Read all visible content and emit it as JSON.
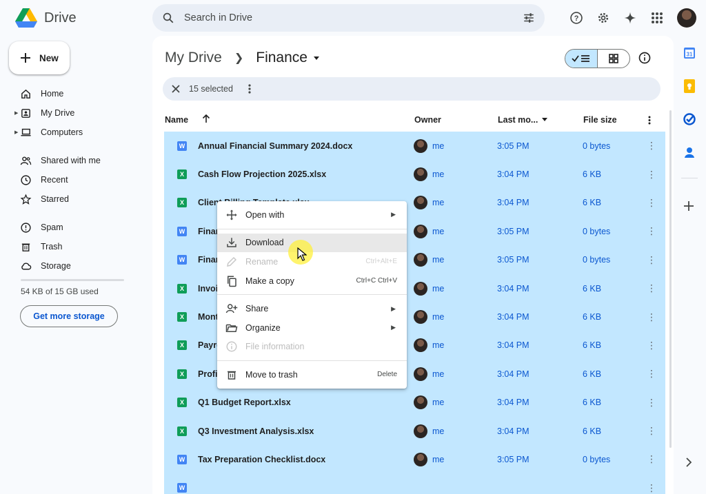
{
  "app": {
    "name": "Drive"
  },
  "search": {
    "placeholder": "Search in Drive"
  },
  "sidebar": {
    "new_label": "New",
    "items": [
      {
        "label": "Home"
      },
      {
        "label": "My Drive"
      },
      {
        "label": "Computers"
      },
      {
        "label": "Shared with me"
      },
      {
        "label": "Recent"
      },
      {
        "label": "Starred"
      },
      {
        "label": "Spam"
      },
      {
        "label": "Trash"
      },
      {
        "label": "Storage"
      }
    ],
    "storage_text": "54 KB of 15 GB used",
    "storage_used_fraction": 0.0,
    "get_storage_label": "Get more storage"
  },
  "breadcrumb": {
    "root": "My Drive",
    "current": "Finance"
  },
  "selection": {
    "count_text": "15 selected"
  },
  "table": {
    "headers": {
      "name": "Name",
      "owner": "Owner",
      "modified": "Last mo...",
      "size": "File size"
    },
    "rows": [
      {
        "type": "docx",
        "glyph": "W",
        "name": "Annual Financial Summary 2024.docx",
        "owner": "me",
        "modified": "3:05 PM",
        "size": "0 bytes"
      },
      {
        "type": "xlsx",
        "glyph": "X",
        "name": "Cash Flow Projection 2025.xlsx",
        "owner": "me",
        "modified": "3:04 PM",
        "size": "6 KB"
      },
      {
        "type": "xlsx",
        "glyph": "X",
        "name": "Client Billing Template.xlsx",
        "owner": "me",
        "modified": "3:04 PM",
        "size": "6 KB"
      },
      {
        "type": "docx",
        "glyph": "W",
        "name": "Financial Audit Notes.docx",
        "owner": "me",
        "modified": "3:05 PM",
        "size": "0 bytes"
      },
      {
        "type": "docx",
        "glyph": "W",
        "name": "Financial Policy Draft.docx",
        "owner": "me",
        "modified": "3:05 PM",
        "size": "0 bytes"
      },
      {
        "type": "xlsx",
        "glyph": "X",
        "name": "Invoice Tracker.xlsx",
        "owner": "me",
        "modified": "3:04 PM",
        "size": "6 KB"
      },
      {
        "type": "xlsx",
        "glyph": "X",
        "name": "Monthly Expenses.xlsx",
        "owner": "me",
        "modified": "3:04 PM",
        "size": "6 KB"
      },
      {
        "type": "xlsx",
        "glyph": "X",
        "name": "Payroll Summary.xlsx",
        "owner": "me",
        "modified": "3:04 PM",
        "size": "6 KB"
      },
      {
        "type": "xlsx",
        "glyph": "X",
        "name": "Profit and Loss.xlsx",
        "owner": "me",
        "modified": "3:04 PM",
        "size": "6 KB"
      },
      {
        "type": "xlsx",
        "glyph": "X",
        "name": "Q1 Budget Report.xlsx",
        "owner": "me",
        "modified": "3:04 PM",
        "size": "6 KB"
      },
      {
        "type": "xlsx",
        "glyph": "X",
        "name": "Q3 Investment Analysis.xlsx",
        "owner": "me",
        "modified": "3:04 PM",
        "size": "6 KB"
      },
      {
        "type": "docx",
        "glyph": "W",
        "name": "Tax Preparation Checklist.docx",
        "owner": "me",
        "modified": "3:05 PM",
        "size": "0 bytes"
      },
      {
        "type": "docx",
        "glyph": "W",
        "name": "",
        "owner": "",
        "modified": "",
        "size": ""
      }
    ]
  },
  "context_menu": {
    "open_with": "Open with",
    "download": "Download",
    "rename": "Rename",
    "rename_shortcut": "Ctrl+Alt+E",
    "make_copy": "Make a copy",
    "make_copy_shortcut": "Ctrl+C Ctrl+V",
    "share": "Share",
    "organize": "Organize",
    "file_info": "File information",
    "trash": "Move to trash",
    "trash_shortcut": "Delete"
  },
  "colors": {
    "selection": "#c2e7ff",
    "accent": "#0b57d0",
    "docx": "#4285f4",
    "xlsx": "#0f9d58"
  }
}
